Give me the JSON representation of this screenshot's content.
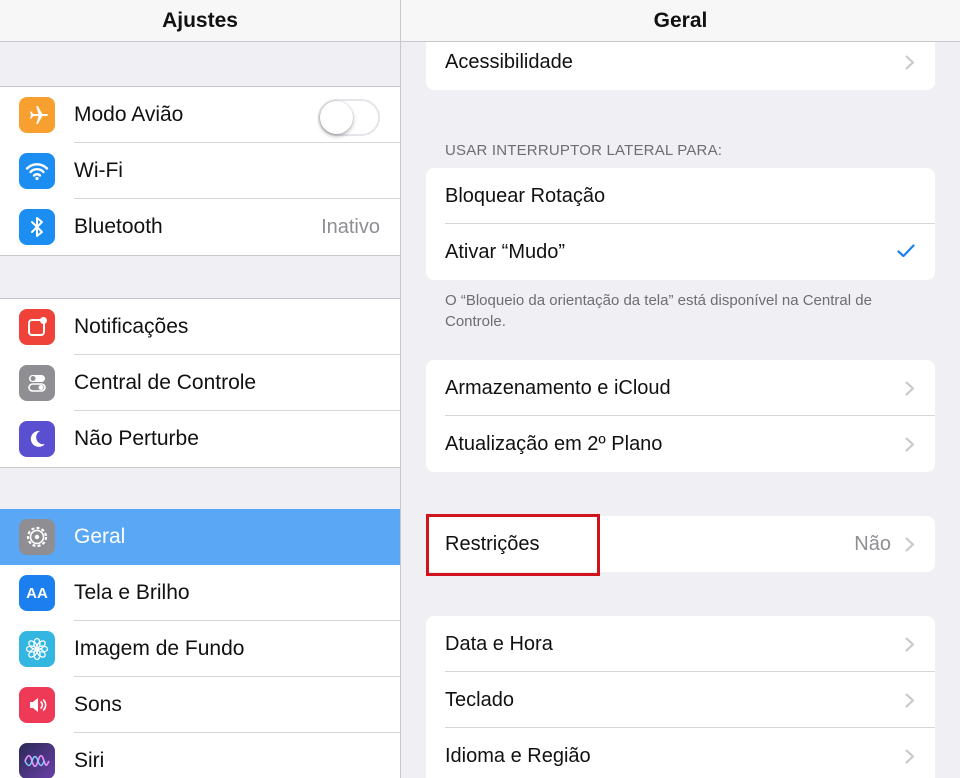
{
  "left": {
    "title": "Ajustes",
    "groups": [
      [
        {
          "label": "Modo Avião",
          "icon": "airplane-icon",
          "color": "#f7a030",
          "toggle": false
        },
        {
          "label": "Wi-Fi",
          "icon": "wifi-icon",
          "color": "#1c8ef2"
        },
        {
          "label": "Bluetooth",
          "icon": "bluetooth-icon",
          "color": "#1c8ef2",
          "value": "Inativo"
        }
      ],
      [
        {
          "label": "Notificações",
          "icon": "notifications-icon",
          "color": "#ef4339"
        },
        {
          "label": "Central de Controle",
          "icon": "control-center-icon",
          "color": "#8e8e93"
        },
        {
          "label": "Não Perturbe",
          "icon": "moon-icon",
          "color": "#5a4fd1"
        }
      ],
      [
        {
          "label": "Geral",
          "icon": "gear-icon",
          "color": "#8e8e93",
          "selected": true
        },
        {
          "label": "Tela e Brilho",
          "icon": "display-brightness-icon",
          "color": "#1c7ff0",
          "glyph": "AA"
        },
        {
          "label": "Imagem de Fundo",
          "icon": "wallpaper-icon",
          "color": "#33b6e0"
        },
        {
          "label": "Sons",
          "icon": "sound-icon",
          "color": "#ee3957"
        },
        {
          "label": "Siri",
          "icon": "siri-icon",
          "color": "#2a2a55"
        }
      ]
    ]
  },
  "right": {
    "title": "Geral",
    "accessibility": "Acessibilidade",
    "switch_header": "USAR INTERRUPTOR LATERAL PARA:",
    "lock_rotation": "Bloquear Rotação",
    "mute": "Ativar “Mudo”",
    "switch_footer": "O “Bloqueio da orientação da tela” está disponível na Central de Controle.",
    "storage": "Armazenamento e iCloud",
    "background_refresh": "Atualização em 2º Plano",
    "restrictions": "Restrições",
    "restrictions_value": "Não",
    "date_time": "Data e Hora",
    "keyboard": "Teclado",
    "language_region": "Idioma e Região"
  },
  "colors": {
    "accent": "#1c7ff0",
    "selected_row": "#5aa7f5",
    "highlight_box": "#d0141d"
  }
}
